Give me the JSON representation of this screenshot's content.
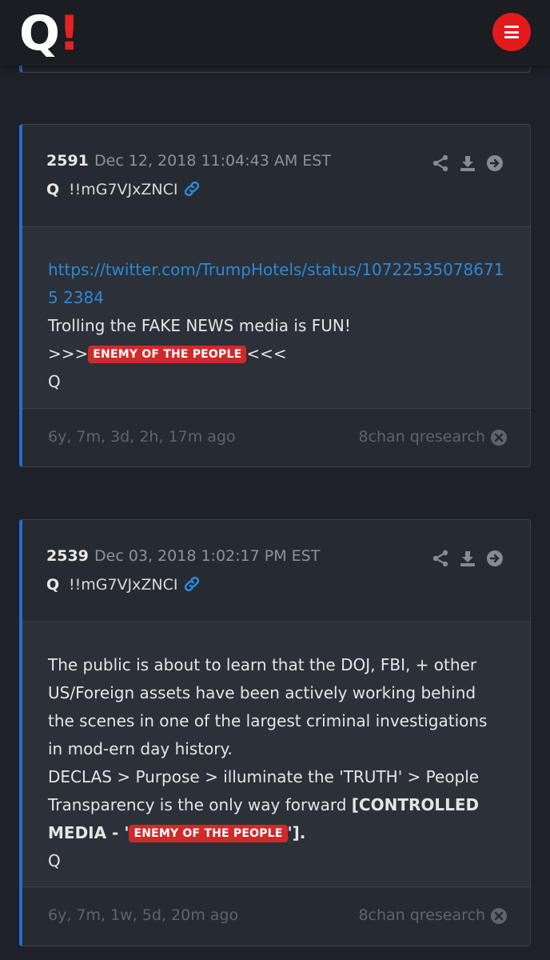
{
  "header": {
    "logo_letter": "Q",
    "logo_mark": "!"
  },
  "posts": [
    {
      "number": "2591",
      "date": "Dec 12, 2018 11:04:43 AM EST",
      "author": "Q",
      "tripcode": "!!mG7VJxZNCI",
      "link": "https://twitter.com/TrumpHotels/status/107225350786715 2384",
      "line1": "Trolling the FAKE NEWS media is FUN!",
      "prefix": ">>>",
      "tag": "ENEMY OF THE PEOPLE",
      "suffix": "<<<",
      "sign": "Q",
      "ago": "6y, 7m, 3d, 2h, 17m ago",
      "source": "8chan qresearch"
    },
    {
      "number": "2539",
      "date": "Dec 03, 2018 1:02:17 PM EST",
      "author": "Q",
      "tripcode": "!!mG7VJxZNCI",
      "para": "The public is about to learn that the DOJ, FBI, + other US/Foreign assets have been actively working behind the scenes in one of the largest criminal investigations in mod-ern day history.",
      "line2": "DECLAS > Purpose > illuminate the 'TRUTH' > People",
      "line3": "Transparency is the only way forward ",
      "bold1": "[CONTROLLED MEDIA - '",
      "tag": "ENEMY OF THE PEOPLE",
      "bold2": "'].",
      "sign": "Q",
      "ago": "6y, 7m, 1w, 5d, 20m ago",
      "source": "8chan qresearch"
    }
  ],
  "colors": {
    "accent": "#1f6fd0",
    "tag_bg": "#cf2a2a",
    "menu_bg": "#e11b1b",
    "link": "#2b89d6"
  }
}
